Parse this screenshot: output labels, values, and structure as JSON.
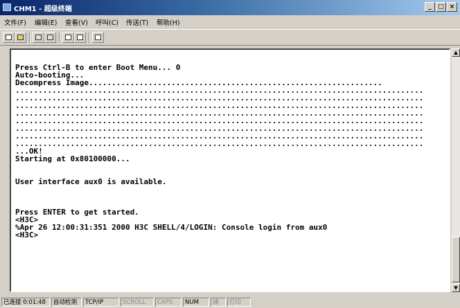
{
  "window": {
    "title": "CHM1 - 超级终端",
    "controls": {
      "minimize": "_",
      "maximize": "□",
      "close": "×"
    }
  },
  "menu": {
    "items": [
      "文件(F)",
      "编辑(E)",
      "查看(V)",
      "呼叫(C)",
      "传送(T)",
      "帮助(H)"
    ]
  },
  "toolbar": {
    "buttons": [
      "new-connection",
      "open",
      "call",
      "disconnect",
      "send",
      "receive",
      "properties"
    ]
  },
  "terminal": {
    "text": "Press Ctrl-B to enter Boot Menu... 0\nAuto-booting...\nDecompress Image................................................................\n.........................................................................................\n.........................................................................................\n.........................................................................................\n.........................................................................................\n.........................................................................................\n.........................................................................................\n.........................................................................................\n.........................................................................................\n...OK!\nStarting at 0x80100000...\n\n\nUser interface aux0 is available.\n\n\n\nPress ENTER to get started.\n<H3C>\n%Apr 26 12:00:31:351 2000 H3C SHELL/4/LOGIN: Console login from aux0\n<H3C>"
  },
  "statusbar": {
    "connected": "已连接 0:01:48",
    "detect": "自动检测",
    "protocol": "TCP/IP",
    "scroll": "SCROLL",
    "caps": "CAPS",
    "num": "NUM",
    "capture": "捕",
    "print": "打印"
  }
}
